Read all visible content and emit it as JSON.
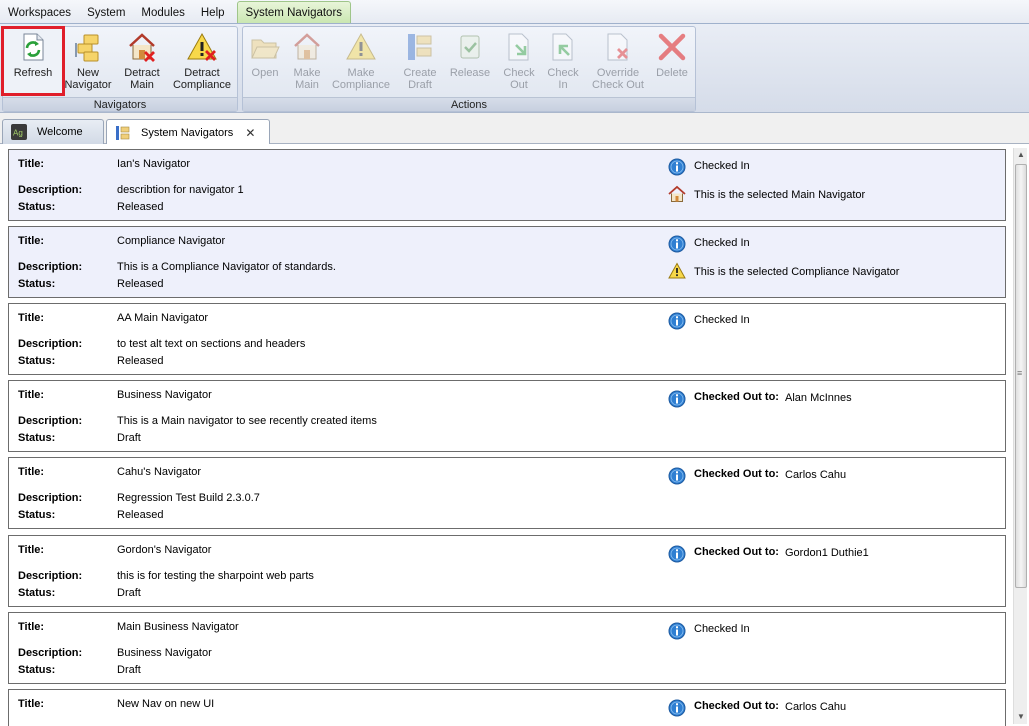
{
  "menu": {
    "items": [
      "Workspaces",
      "System",
      "Modules",
      "Help"
    ],
    "active_tab": "System Navigators"
  },
  "ribbon": {
    "navigators_group": {
      "label": "Navigators",
      "buttons": [
        {
          "line1": "Refresh",
          "line2": "",
          "icon": "refresh-icon"
        },
        {
          "line1": "New",
          "line2": "Navigator",
          "icon": "new-navigator-icon"
        },
        {
          "line1": "Detract",
          "line2": "Main",
          "icon": "detract-main-icon"
        },
        {
          "line1": "Detract",
          "line2": "Compliance",
          "icon": "detract-compliance-icon"
        }
      ]
    },
    "actions_group": {
      "label": "Actions",
      "buttons": [
        {
          "line1": "Open",
          "line2": "",
          "icon": "open-folder-icon"
        },
        {
          "line1": "Make",
          "line2": "Main",
          "icon": "make-main-icon"
        },
        {
          "line1": "Make",
          "line2": "Compliance",
          "icon": "make-compliance-icon"
        },
        {
          "line1": "Create",
          "line2": "Draft",
          "icon": "create-draft-icon"
        },
        {
          "line1": "Release",
          "line2": "",
          "icon": "release-icon"
        },
        {
          "line1": "Check",
          "line2": "Out",
          "icon": "check-out-icon"
        },
        {
          "line1": "Check",
          "line2": "In",
          "icon": "check-in-icon"
        },
        {
          "line1": "Override",
          "line2": "Check Out",
          "icon": "override-check-out-icon"
        },
        {
          "line1": "Delete",
          "line2": "",
          "icon": "delete-icon"
        }
      ]
    }
  },
  "tabs": [
    {
      "label": "Welcome",
      "icon": "welcome-logo-icon"
    },
    {
      "label": "System Navigators",
      "icon": "navigators-icon",
      "close": "✕"
    }
  ],
  "labels": {
    "title": "Title:",
    "description": "Description:",
    "status": "Status:",
    "checked_out_to": "Checked Out to:"
  },
  "navigators": [
    {
      "title": "Ian's Navigator",
      "description": "describtion for navigator 1",
      "status": "Released",
      "checked": "Checked In",
      "checked_out_to": "",
      "note": "This is the selected Main Navigator",
      "note_icon": "home-icon"
    },
    {
      "title": "Compliance Navigator",
      "description": "This is a Compliance Navigator of standards.",
      "status": "Released",
      "checked": "Checked In",
      "checked_out_to": "",
      "note": "This is the selected Compliance Navigator",
      "note_icon": "warning-icon"
    },
    {
      "title": "AA Main Navigator",
      "description": "to test alt text on sections and headers",
      "status": "Released",
      "checked": "Checked In",
      "checked_out_to": "",
      "note": "",
      "note_icon": ""
    },
    {
      "title": "Business Navigator",
      "description": "This is a Main navigator to see recently created items",
      "status": "Draft",
      "checked": "",
      "checked_out_to": "Alan McInnes",
      "note": "",
      "note_icon": ""
    },
    {
      "title": "Cahu's Navigator",
      "description": "Regression Test Build 2.3.0.7",
      "status": "Released",
      "checked": "",
      "checked_out_to": "Carlos Cahu",
      "note": "",
      "note_icon": ""
    },
    {
      "title": "Gordon's Navigator",
      "description": "this is for testing the sharpoint web parts",
      "status": "Draft",
      "checked": "",
      "checked_out_to": "Gordon1 Duthie1",
      "note": "",
      "note_icon": ""
    },
    {
      "title": "Main Business Navigator",
      "description": "Business Navigator",
      "status": "Draft",
      "checked": "Checked In",
      "checked_out_to": "",
      "note": "",
      "note_icon": ""
    },
    {
      "title": "New Nav on new UI",
      "description": "",
      "status": "",
      "checked": "",
      "checked_out_to": "Carlos Cahu",
      "note": "",
      "note_icon": ""
    }
  ],
  "colors": {
    "selected_highlight": "#e01e2a",
    "selected_card_bg": "#eef0fb",
    "info_blue": "#2f7fd2"
  }
}
